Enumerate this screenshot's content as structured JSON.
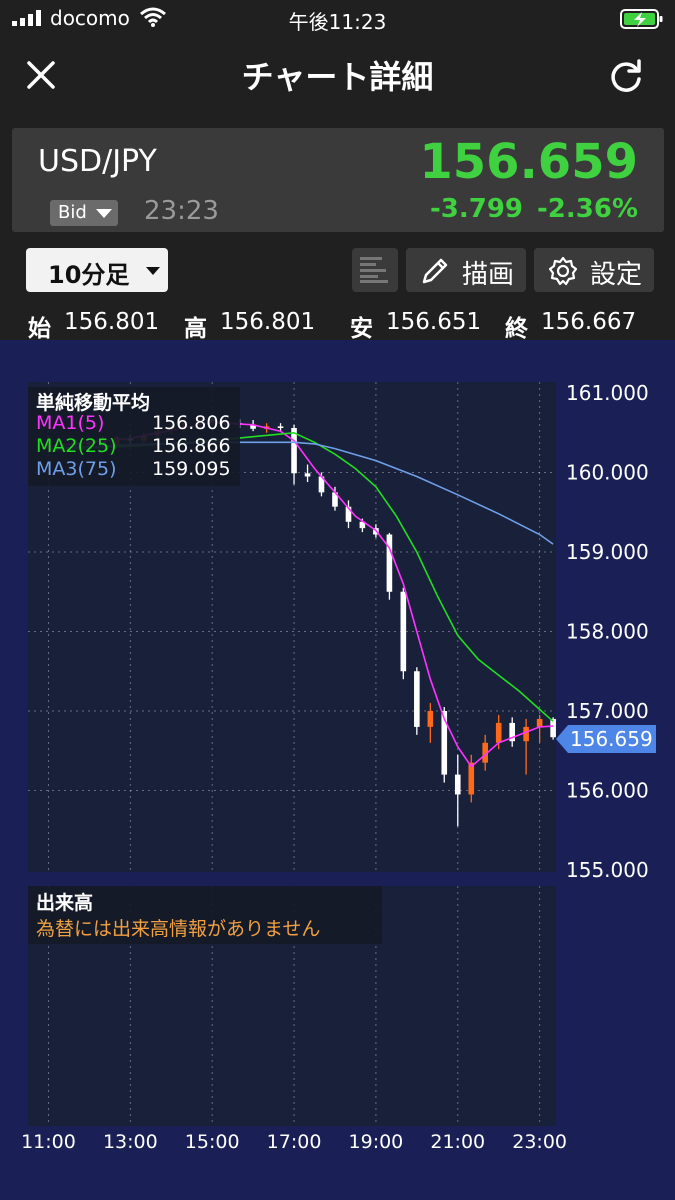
{
  "status_bar": {
    "carrier": "docomo",
    "time": "午後11:23",
    "icons": [
      "cellular-signal-icon",
      "wifi-icon",
      "battery-charging-icon"
    ]
  },
  "nav": {
    "title": "チャート詳細",
    "close_icon": "close-icon",
    "refresh_icon": "refresh-icon"
  },
  "quote": {
    "symbol": "USD/JPY",
    "price": "156.659",
    "price_type": "Bid",
    "time": "23:23",
    "change": "-3.799",
    "change_pct": "-2.36%"
  },
  "toolbar": {
    "timeframe": "10分足",
    "draw_label": "描画",
    "settings_label": "設定"
  },
  "ohlc": {
    "open_label": "始",
    "open": "156.801",
    "high_label": "高",
    "high": "156.801",
    "low_label": "安",
    "low": "156.651",
    "close_label": "終",
    "close": "156.667"
  },
  "colors": {
    "up": "#ff6a1a",
    "down": "#ffffff",
    "ma1": "#ff33ff",
    "ma2": "#22dd22",
    "ma3": "#6f9fe8",
    "accent_green": "#3fd13f",
    "chart_bg": "#1a1f55",
    "plot_bg": "#18203a",
    "last_price_badge": "#4d86e6"
  },
  "legend": {
    "title": "単純移動平均",
    "ma1_name": "MA1(5)",
    "ma1_value": "156.806",
    "ma2_name": "MA2(25)",
    "ma2_value": "156.866",
    "ma3_name": "MA3(75)",
    "ma3_value": "159.095"
  },
  "volume": {
    "title": "出来高",
    "note": "為替には出来高情報がありません"
  },
  "last_price_label": "156.659",
  "chart_data": {
    "type": "candlestick",
    "x_tick_labels": [
      "11:00",
      "13:00",
      "15:00",
      "17:00",
      "19:00",
      "21:00",
      "23:00"
    ],
    "x_tick_hours": [
      11,
      13,
      15,
      17,
      19,
      21,
      23
    ],
    "y_tick_labels": [
      "161.000",
      "160.000",
      "159.000",
      "158.000",
      "157.000",
      "156.000",
      "155.000"
    ],
    "y_tick_values": [
      161,
      160,
      159,
      158,
      157,
      156,
      155
    ],
    "ylim": [
      155,
      161
    ],
    "xlim_hours": [
      11,
      23
    ],
    "grid": true,
    "last_price": 156.659,
    "candles": [
      {
        "t": 11.0,
        "o": 160.3,
        "h": 160.38,
        "l": 160.26,
        "c": 160.34
      },
      {
        "t": 11.33,
        "o": 160.34,
        "h": 160.4,
        "l": 160.3,
        "c": 160.37
      },
      {
        "t": 11.67,
        "o": 160.37,
        "h": 160.42,
        "l": 160.32,
        "c": 160.35
      },
      {
        "t": 12.0,
        "o": 160.35,
        "h": 160.42,
        "l": 160.3,
        "c": 160.39
      },
      {
        "t": 12.33,
        "o": 160.39,
        "h": 160.45,
        "l": 160.33,
        "c": 160.36
      },
      {
        "t": 12.67,
        "o": 160.36,
        "h": 160.46,
        "l": 160.33,
        "c": 160.44
      },
      {
        "t": 13.0,
        "o": 160.44,
        "h": 160.48,
        "l": 160.36,
        "c": 160.4
      },
      {
        "t": 13.33,
        "o": 160.4,
        "h": 160.5,
        "l": 160.37,
        "c": 160.47
      },
      {
        "t": 13.67,
        "o": 160.47,
        "h": 160.56,
        "l": 160.42,
        "c": 160.53
      },
      {
        "t": 14.0,
        "o": 160.53,
        "h": 160.6,
        "l": 160.49,
        "c": 160.57
      },
      {
        "t": 14.33,
        "o": 160.57,
        "h": 160.66,
        "l": 160.52,
        "c": 160.63
      },
      {
        "t": 14.67,
        "o": 160.63,
        "h": 160.7,
        "l": 160.58,
        "c": 160.67
      },
      {
        "t": 15.0,
        "o": 160.67,
        "h": 160.72,
        "l": 160.6,
        "c": 160.64
      },
      {
        "t": 15.33,
        "o": 160.64,
        "h": 160.69,
        "l": 160.58,
        "c": 160.62
      },
      {
        "t": 15.67,
        "o": 160.62,
        "h": 160.67,
        "l": 160.56,
        "c": 160.6
      },
      {
        "t": 16.0,
        "o": 160.6,
        "h": 160.66,
        "l": 160.52,
        "c": 160.55
      },
      {
        "t": 16.33,
        "o": 160.55,
        "h": 160.62,
        "l": 160.5,
        "c": 160.58
      },
      {
        "t": 16.67,
        "o": 160.58,
        "h": 160.62,
        "l": 160.52,
        "c": 160.56
      },
      {
        "t": 17.0,
        "o": 160.56,
        "h": 160.6,
        "l": 159.85,
        "c": 159.99
      },
      {
        "t": 17.33,
        "o": 159.99,
        "h": 160.1,
        "l": 159.88,
        "c": 159.95
      },
      {
        "t": 17.67,
        "o": 159.95,
        "h": 160.0,
        "l": 159.7,
        "c": 159.75
      },
      {
        "t": 18.0,
        "o": 159.75,
        "h": 159.82,
        "l": 159.52,
        "c": 159.57
      },
      {
        "t": 18.33,
        "o": 159.57,
        "h": 159.65,
        "l": 159.3,
        "c": 159.38
      },
      {
        "t": 18.67,
        "o": 159.38,
        "h": 159.42,
        "l": 159.25,
        "c": 159.3
      },
      {
        "t": 19.0,
        "o": 159.3,
        "h": 159.35,
        "l": 159.18,
        "c": 159.22
      },
      {
        "t": 19.33,
        "o": 159.22,
        "h": 159.24,
        "l": 158.4,
        "c": 158.5
      },
      {
        "t": 19.67,
        "o": 158.5,
        "h": 158.55,
        "l": 157.4,
        "c": 157.5
      },
      {
        "t": 20.0,
        "o": 157.5,
        "h": 157.55,
        "l": 156.7,
        "c": 156.8
      },
      {
        "t": 20.33,
        "o": 156.8,
        "h": 157.1,
        "l": 156.6,
        "c": 157.0
      },
      {
        "t": 20.67,
        "o": 157.0,
        "h": 157.05,
        "l": 156.1,
        "c": 156.2
      },
      {
        "t": 21.0,
        "o": 156.2,
        "h": 156.45,
        "l": 155.55,
        "c": 155.95
      },
      {
        "t": 21.33,
        "o": 155.95,
        "h": 156.45,
        "l": 155.85,
        "c": 156.35
      },
      {
        "t": 21.67,
        "o": 156.35,
        "h": 156.7,
        "l": 156.25,
        "c": 156.6
      },
      {
        "t": 22.0,
        "o": 156.6,
        "h": 156.95,
        "l": 156.52,
        "c": 156.85
      },
      {
        "t": 22.33,
        "o": 156.85,
        "h": 156.92,
        "l": 156.55,
        "c": 156.62
      },
      {
        "t": 22.67,
        "o": 156.62,
        "h": 156.9,
        "l": 156.2,
        "c": 156.8
      },
      {
        "t": 23.0,
        "o": 156.8,
        "h": 156.95,
        "l": 156.6,
        "c": 156.9
      },
      {
        "t": 23.33,
        "o": 156.9,
        "h": 156.92,
        "l": 156.64,
        "c": 156.67
      }
    ],
    "series": [
      {
        "name": "MA1(5)",
        "x": [
          11,
          12,
          13,
          14,
          15,
          16,
          16.67,
          17.0,
          17.5,
          18.0,
          18.5,
          19.0,
          19.33,
          19.67,
          20.0,
          20.33,
          20.67,
          21.0,
          21.33,
          21.67,
          22.0,
          22.5,
          23.0,
          23.33
        ],
        "y": [
          160.33,
          160.38,
          160.43,
          160.53,
          160.63,
          160.6,
          160.52,
          160.4,
          160.05,
          159.75,
          159.45,
          159.27,
          159.05,
          158.6,
          158.0,
          157.4,
          156.9,
          156.55,
          156.3,
          156.45,
          156.6,
          156.7,
          156.8,
          156.81
        ]
      },
      {
        "name": "MA2(25)",
        "x": [
          11,
          13,
          15,
          16,
          17,
          17.5,
          18,
          18.5,
          19,
          19.5,
          20,
          20.5,
          21,
          21.5,
          22,
          22.5,
          23,
          23.33
        ],
        "y": [
          160.28,
          160.33,
          160.4,
          160.45,
          160.5,
          160.38,
          160.23,
          160.05,
          159.82,
          159.45,
          159.0,
          158.45,
          157.95,
          157.65,
          157.45,
          157.25,
          157.02,
          156.87
        ]
      },
      {
        "name": "MA3(75)",
        "x": [
          11,
          13,
          15,
          17,
          17.5,
          18,
          19,
          20,
          21,
          22,
          23,
          23.33
        ],
        "y": [
          160.3,
          160.35,
          160.38,
          160.38,
          160.36,
          160.3,
          160.15,
          159.95,
          159.72,
          159.48,
          159.22,
          159.1
        ]
      }
    ]
  }
}
